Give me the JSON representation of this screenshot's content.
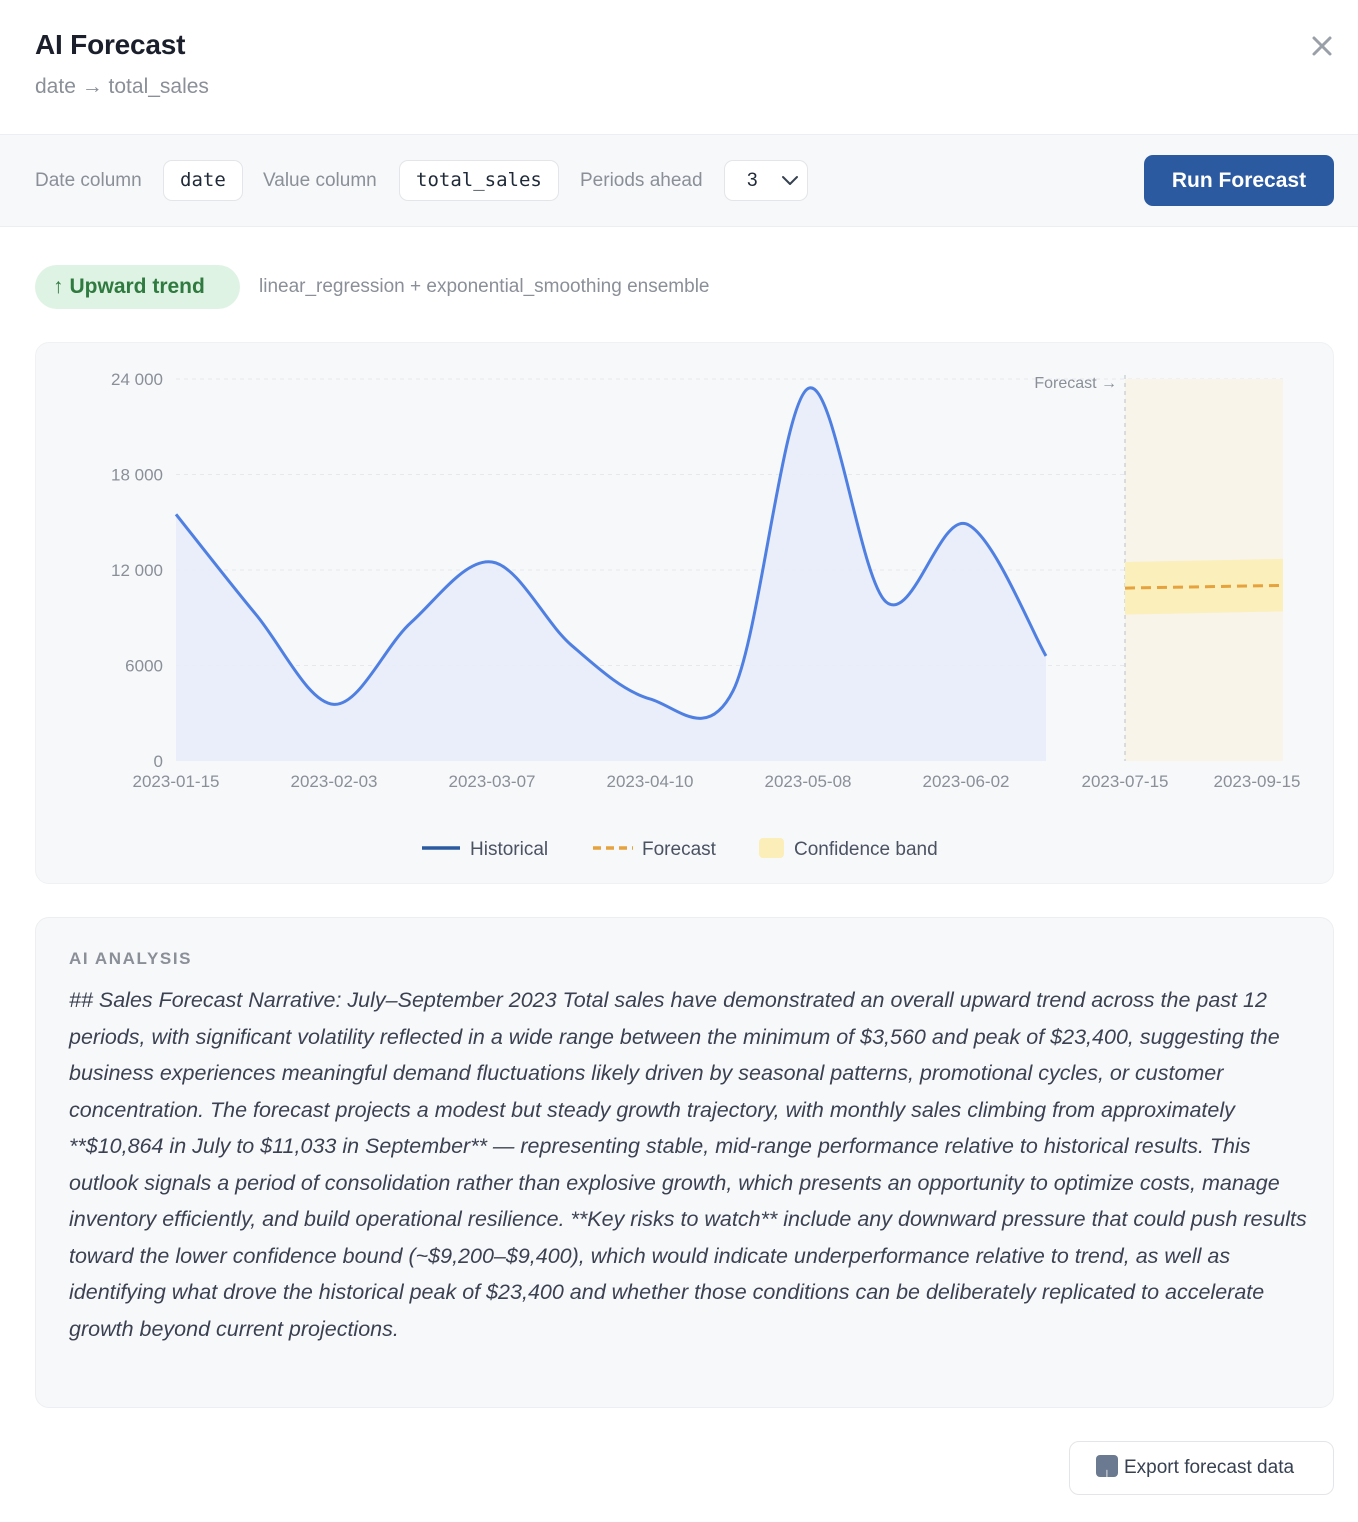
{
  "header": {
    "title": "AI Forecast",
    "subtitle": "date → total_sales"
  },
  "controls": {
    "date_label": "Date column",
    "date_value": "date",
    "value_label": "Value column",
    "value_value": "total_sales",
    "periods_label": "Periods ahead",
    "periods_value": "3",
    "run_label": "Run Forecast"
  },
  "trend": {
    "arrow": "↑",
    "label": "Upward trend",
    "model": "linear_regression + exponential_smoothing ensemble"
  },
  "colors": {
    "accent": "#2b5aa0",
    "historical_line": "#4f80e1",
    "forecast_line": "#e6a23c",
    "band": "#fbeeb8",
    "trend_bg": "#dff3e4",
    "trend_text": "#2f7a3f"
  },
  "chart_data": {
    "type": "line",
    "x_ticks": [
      "2023-01-15",
      "2023-02-03",
      "2023-03-07",
      "2023-04-10",
      "2023-05-08",
      "2023-06-02",
      "2023-07-15",
      "2023-09-15"
    ],
    "y_ticks": [
      "0",
      "6000",
      "12 000",
      "18 000",
      "24 000"
    ],
    "ylim": [
      0,
      24000
    ],
    "forecast_marker": "Forecast →",
    "series": [
      {
        "name": "Historical",
        "x": [
          "2023-01-15",
          "2023-01-25",
          "2023-02-03",
          "2023-02-20",
          "2023-03-07",
          "2023-03-25",
          "2023-04-10",
          "2023-04-22",
          "2023-05-08",
          "2023-05-20",
          "2023-06-02",
          "2023-06-10"
        ],
        "values": [
          15500,
          9200,
          3560,
          8700,
          12500,
          7300,
          3900,
          4400,
          23400,
          10000,
          14900,
          6600
        ]
      },
      {
        "name": "Forecast",
        "x": [
          "2023-07-15",
          "2023-09-15"
        ],
        "values": [
          10864,
          11033
        ]
      }
    ],
    "confidence_band": {
      "name": "Confidence band",
      "x": [
        "2023-07-15",
        "2023-09-15"
      ],
      "lower": [
        9200,
        9400
      ],
      "upper": [
        12500,
        12700
      ]
    },
    "legend": [
      "Historical",
      "Forecast",
      "Confidence band"
    ],
    "legend_position": "bottom"
  },
  "analysis": {
    "label": "AI ANALYSIS",
    "text": "## Sales Forecast Narrative: July–September 2023 Total sales have demonstrated an overall upward trend across the past 12 periods, with significant volatility reflected in a wide range between the minimum of $3,560 and peak of $23,400, suggesting the business experiences meaningful demand fluctuations likely driven by seasonal patterns, promotional cycles, or customer concentration. The forecast projects a modest but steady growth trajectory, with monthly sales climbing from approximately **$10,864 in July to $11,033 in September** — representing stable, mid-range performance relative to historical results. This outlook signals a period of consolidation rather than explosive growth, which presents an opportunity to optimize costs, manage inventory efficiently, and build operational resilience. **Key risks to watch** include any downward pressure that could push results toward the lower confidence bound (~$9,200–$9,400), which would indicate underperformance relative to trend, as well as identifying what drove the historical peak of $23,400 and whether those conditions can be deliberately replicated to accelerate growth beyond current projections."
  },
  "footer": {
    "export_label": "Export forecast data",
    "export_icon": "download-icon"
  }
}
